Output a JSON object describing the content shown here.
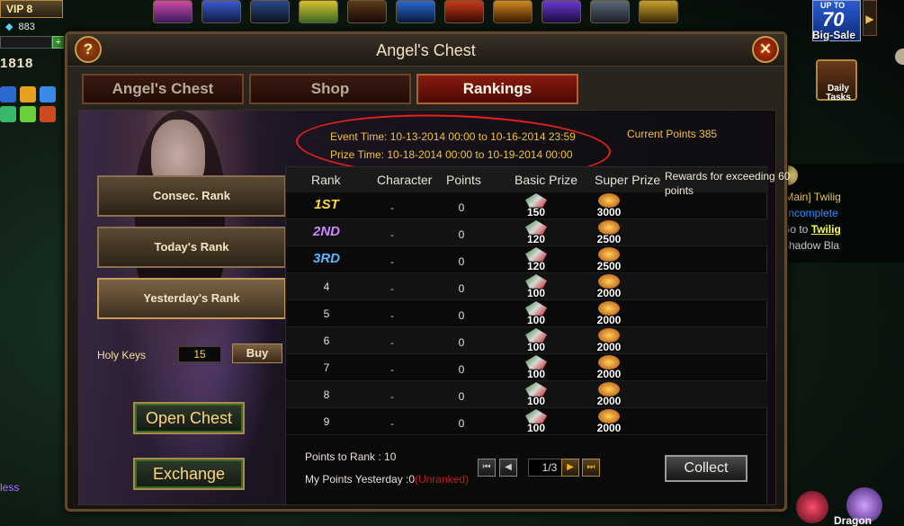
{
  "hud": {
    "vip": "VIP 8",
    "gems": "883",
    "power": "1818",
    "side_link": "less",
    "sale": {
      "upto": "UP TO",
      "number": "70",
      "label": "Big-Sale"
    },
    "daily_tasks": "Daily Tasks",
    "quest": {
      "line1": "[Main] Twilig",
      "line2": "(Incomplete",
      "line3_prefix": "Go to ",
      "line3_link": "Twilig",
      "line4": "Shadow Bla"
    },
    "dragon_label": "Dragon"
  },
  "dialog": {
    "title": "Angel's Chest",
    "help": "?",
    "close": "✕",
    "tabs": [
      {
        "label": "Angel's Chest",
        "active": false
      },
      {
        "label": "Shop",
        "active": false
      },
      {
        "label": "Rankings",
        "active": true
      }
    ],
    "event_time": "Event Time: 10-13-2014 00:00 to 10-16-2014 23:59",
    "prize_time": "Prize Time: 10-18-2014 00:00 to 10-19-2014 00:00",
    "current_points": "Current Points 385",
    "rank_buttons": {
      "consec": "Consec. Rank",
      "today": "Today's Rank",
      "yesterday": "Yesterday's Rank"
    },
    "holy_keys_label": "Holy Keys",
    "holy_keys_value": "15",
    "buy": "Buy",
    "open_chest": "Open Chest",
    "exchange": "Exchange",
    "table": {
      "headers": {
        "rank": "Rank",
        "character": "Character",
        "points": "Points",
        "basic_prize": "Basic Prize",
        "super_prize": "Super Prize"
      },
      "rewards_note": "Rewards for exceeding 60 points",
      "rows": [
        {
          "rank": "1ST",
          "character": "-",
          "points": "0",
          "basic": "150",
          "super": "3000"
        },
        {
          "rank": "2ND",
          "character": "-",
          "points": "0",
          "basic": "120",
          "super": "2500"
        },
        {
          "rank": "3RD",
          "character": "-",
          "points": "0",
          "basic": "120",
          "super": "2500"
        },
        {
          "rank": "4",
          "character": "-",
          "points": "0",
          "basic": "100",
          "super": "2000"
        },
        {
          "rank": "5",
          "character": "-",
          "points": "0",
          "basic": "100",
          "super": "2000"
        },
        {
          "rank": "6",
          "character": "-",
          "points": "0",
          "basic": "100",
          "super": "2000"
        },
        {
          "rank": "7",
          "character": "-",
          "points": "0",
          "basic": "100",
          "super": "2000"
        },
        {
          "rank": "8",
          "character": "-",
          "points": "0",
          "basic": "100",
          "super": "2000"
        },
        {
          "rank": "9",
          "character": "-",
          "points": "0",
          "basic": "100",
          "super": "2000"
        }
      ]
    },
    "points_to_rank": "Points to Rank : 10",
    "my_points_yesterday": "My Points Yesterday :0",
    "unranked": "(Unranked)",
    "pager": {
      "first": "⏮",
      "prev": "◀",
      "page": "1/3",
      "next": "▶",
      "last": "⏭"
    },
    "collect": "Collect"
  }
}
